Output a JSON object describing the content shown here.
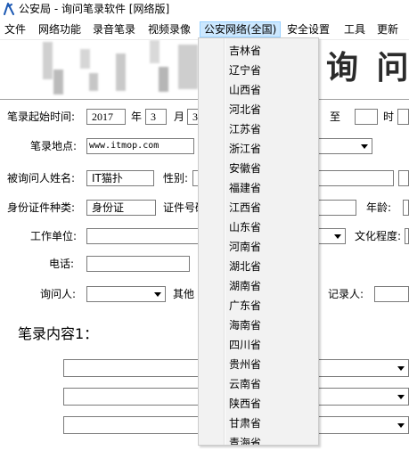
{
  "window": {
    "title": "公安局 - 询问笔录软件  [网络版]"
  },
  "menu": {
    "items": [
      "文件",
      "网络功能",
      "录音笔录",
      "视频录像",
      "公安网络(全国)",
      "安全设置",
      "工具",
      "更新"
    ],
    "active_index": 4
  },
  "dropdown": {
    "items": [
      "吉林省",
      "辽宁省",
      "山西省",
      "河北省",
      "江苏省",
      "浙江省",
      "安徽省",
      "福建省",
      "江西省",
      "山东省",
      "河南省",
      "湖北省",
      "湖南省",
      "广东省",
      "海南省",
      "四川省",
      "贵州省",
      "云南省",
      "陕西省",
      "甘肃省",
      "青海省"
    ]
  },
  "header": {
    "title": "询 问"
  },
  "form": {
    "start_time_label": "笔录起始时间:",
    "year": "2017",
    "year_unit": "年",
    "month": "3",
    "month_unit": "月",
    "day": "3",
    "to_label": "至",
    "hour_unit": "时",
    "location_label": "笔录地点:",
    "location_value": "www.itmop.com",
    "name_label": "被询问人姓名:",
    "name_value": "IT猫扑",
    "gender_label": "性别:",
    "id_type_label": "身份证件种类:",
    "id_type_value": "身份证",
    "id_number_label": "证件号码",
    "age_label": "年龄:",
    "work_unit_label": "工作单位:",
    "education_label": "文化程度:",
    "phone_label": "电话:",
    "interrogator_label": "询问人:",
    "other_label": "其他",
    "recorder_label": "记录人:",
    "content_label": "笔录内容1："
  },
  "colors": {
    "menu_active_bg": "#cce8ff",
    "menu_active_border": "#99d1ff",
    "dropdown_bg": "#f2f2f2",
    "dropdown_border": "#cccccc",
    "input_border": "#7a7a7a",
    "app_icon": "#1e5ab4"
  }
}
